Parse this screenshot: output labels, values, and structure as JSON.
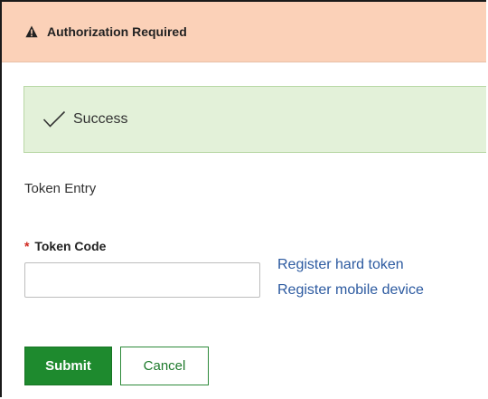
{
  "header": {
    "icon": "warning-icon",
    "title": "Authorization Required",
    "background": "#fbd1b8"
  },
  "alert": {
    "icon": "checkmark-icon",
    "message": "Success",
    "background": "#e3f1d9"
  },
  "form": {
    "section_label": "Token Entry",
    "required_marker": "*",
    "token_label": "Token Code",
    "token_value": "",
    "token_placeholder": ""
  },
  "links": {
    "hard_token": "Register hard token",
    "mobile_device": "Register mobile device",
    "color": "#2c5aa0"
  },
  "buttons": {
    "submit": "Submit",
    "cancel": "Cancel",
    "submit_color": "#1e8a2e"
  }
}
